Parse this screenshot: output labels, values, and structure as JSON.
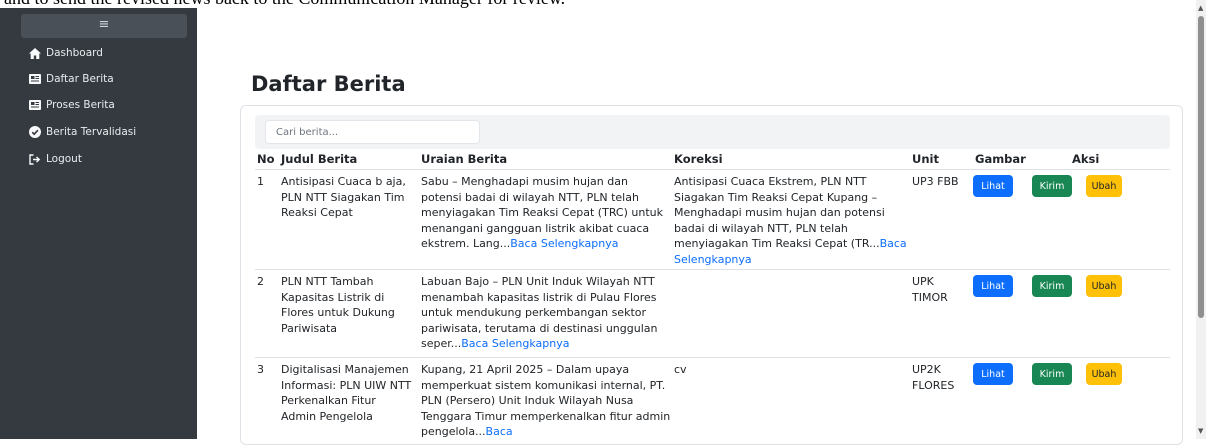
{
  "caption_text": "and to send the revised news back to the Communication Manager for review.",
  "sidebar": {
    "toggle": "≡",
    "items": [
      {
        "label": "Dashboard",
        "icon": "home-icon"
      },
      {
        "label": "Daftar Berita",
        "icon": "newspaper-icon"
      },
      {
        "label": "Proses Berita",
        "icon": "newspaper-icon"
      },
      {
        "label": "Berita Tervalidasi",
        "icon": "check-circle-icon"
      },
      {
        "label": "Logout",
        "icon": "logout-icon"
      }
    ]
  },
  "page_title": "Daftar Berita",
  "search": {
    "placeholder": "Cari berita..."
  },
  "table": {
    "headers": [
      "No",
      "Judul Berita",
      "Uraian Berita",
      "Koreksi",
      "Unit",
      "Gambar",
      "Aksi"
    ],
    "read_more": "Baca Selengkapnya",
    "buttons": {
      "view": "Lihat",
      "send": "Kirim",
      "edit": "Ubah"
    },
    "rows": [
      {
        "no": "1",
        "title": "Antisipasi Cuaca b aja, PLN NTT Siagakan Tim Reaksi Cepat",
        "desc": "Sabu – Menghadapi musim hujan dan potensi badai di wilayah NTT, PLN telah menyiagakan Tim Reaksi Cepat (TRC) untuk menangani gangguan listrik akibat cuaca ekstrem. Lang...",
        "desc_link": "Baca Selengkapnya",
        "correction": "Antisipasi Cuaca Ekstrem, PLN NTT Siagakan Tim Reaksi Cepat Kupang – Menghadapi musim hujan dan potensi badai di wilayah NTT, PLN telah menyiagakan Tim Reaksi Cepat (TR...",
        "correction_link": "Baca Selengkapnya",
        "unit": "UP3 FBB"
      },
      {
        "no": "2",
        "title": "PLN NTT Tambah Kapasitas Listrik di Flores untuk Dukung Pariwisata",
        "desc": "Labuan Bajo – PLN Unit Induk Wilayah NTT menambah kapasitas listrik di Pulau Flores untuk mendukung perkembangan sektor pariwisata, terutama di destinasi unggulan seper...",
        "desc_link": "Baca Selengkapnya",
        "correction": "",
        "correction_link": "",
        "unit": "UPK TIMOR"
      },
      {
        "no": "3",
        "title": "Digitalisasi Manajemen Informasi: PLN UIW NTT Perkenalkan Fitur Admin Pengelola",
        "desc": "Kupang, 21 April 2025 – Dalam upaya memperkuat sistem komunikasi internal, PT. PLN (Persero) Unit Induk Wilayah Nusa Tenggara Timur memperkenalkan fitur admin pengelola...",
        "desc_link": "Baca",
        "correction": "cv",
        "correction_link": "",
        "unit": "UP2K FLORES"
      }
    ]
  },
  "colors": {
    "sidebar_bg": "#343a40",
    "primary": "#0d6efd",
    "success": "#198754",
    "warning": "#ffc107"
  }
}
